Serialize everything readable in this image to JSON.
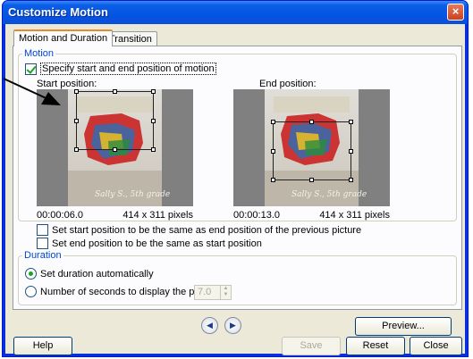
{
  "window": {
    "title": "Customize Motion",
    "close_glyph": "×"
  },
  "tabs": [
    {
      "label": "Motion and Duration",
      "active": true
    },
    {
      "label": "Transition",
      "active": false
    }
  ],
  "motion": {
    "group_label": "Motion",
    "specify_checkbox": {
      "label": "Specify start and end position of motion",
      "checked": true
    },
    "start": {
      "label": "Start position:",
      "time": "00:00:06.0",
      "size": "414 x 311 pixels"
    },
    "end": {
      "label": "End position:",
      "time": "00:00:13.0",
      "size": "414 x 311 pixels"
    },
    "photo_caption": "Sally S., 5th grade",
    "same_as_prev_checkbox": {
      "label": "Set start position to be the same as end position of the previous picture",
      "checked": false
    },
    "same_as_start_checkbox": {
      "label": "Set end position to be the same as start position",
      "checked": false
    }
  },
  "duration": {
    "group_label": "Duration",
    "auto_radio": {
      "label": "Set duration automatically",
      "checked": true
    },
    "seconds_radio": {
      "label": "Number of seconds to display the picture",
      "checked": false
    },
    "seconds_value": "7.0"
  },
  "nav": {
    "prev_glyph": "◀",
    "next_glyph": "▶"
  },
  "buttons": {
    "preview": "Preview...",
    "help": "Help",
    "save": "Save",
    "reset": "Reset",
    "close": "Close"
  },
  "colors": {
    "title_bar": "#0554e3",
    "group_label": "#0046d5",
    "check_mark": "#21a121",
    "tab_highlight": "#e68b2c"
  }
}
